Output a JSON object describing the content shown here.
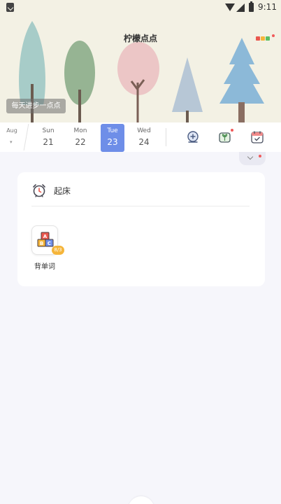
{
  "status_bar": {
    "time": "9:11",
    "icons": [
      "app-notification-icon",
      "wifi-icon",
      "signal-icon",
      "battery-icon"
    ]
  },
  "header": {
    "title": "柠檬点点",
    "motto": "每天进步一点点",
    "menu_dots_colors": [
      "#e9574d",
      "#f5b53a",
      "#5cbd64"
    ],
    "notify_dot_color": "#f05a5a"
  },
  "date_bar": {
    "month": "Aug",
    "month_arrow": "▾",
    "days": [
      {
        "weekday": "Sun",
        "date": "21",
        "selected": false
      },
      {
        "weekday": "Mon",
        "date": "22",
        "selected": false
      },
      {
        "weekday": "Tue",
        "date": "23",
        "selected": true
      },
      {
        "weekday": "Wed",
        "date": "24",
        "selected": false
      }
    ],
    "tools": [
      "add-habit-icon",
      "plant-icon",
      "calendar-check-icon"
    ],
    "accent_color": "#6e8ee8"
  },
  "section": {
    "title": "起床",
    "icon": "alarm-clock-icon",
    "habits": [
      {
        "label": "背单词",
        "badge": "8/3",
        "icon": "abc-blocks-icon"
      }
    ]
  }
}
